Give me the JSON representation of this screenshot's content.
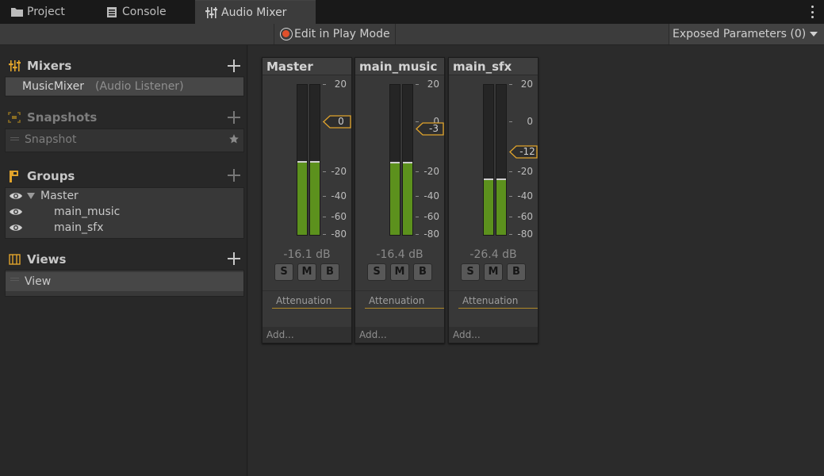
{
  "tabs": [
    {
      "label": "Project",
      "icon": "folder-icon"
    },
    {
      "label": "Console",
      "icon": "console-icon"
    },
    {
      "label": "Audio Mixer",
      "icon": "mixer-icon",
      "active": true
    }
  ],
  "toolbar": {
    "edit_play_mode": "Edit in Play Mode",
    "exposed_parameters": "Exposed Parameters (0)"
  },
  "sidebar": {
    "mixers": {
      "title": "Mixers",
      "items": [
        {
          "name": "MusicMixer",
          "note": "(Audio Listener)"
        }
      ]
    },
    "snapshots": {
      "title": "Snapshots",
      "items": [
        {
          "name": "Snapshot"
        }
      ]
    },
    "groups": {
      "title": "Groups",
      "items": [
        {
          "name": "Master",
          "level": 0
        },
        {
          "name": "main_music",
          "level": 1
        },
        {
          "name": "main_sfx",
          "level": 1
        }
      ]
    },
    "views": {
      "title": "Views",
      "items": [
        {
          "name": "View"
        }
      ]
    }
  },
  "strips": [
    {
      "name": "Master",
      "db": "-16.1 dB",
      "fader_label": "0",
      "fader_db": 0,
      "level_db": -16.1,
      "peak_db": -16.1
    },
    {
      "name": "main_music",
      "db": "-16.4 dB",
      "fader_label": "-3",
      "fader_db": -3,
      "level_db": -16.4,
      "peak_db": -16.4
    },
    {
      "name": "main_sfx",
      "db": "-26.4 dB",
      "fader_label": "-12",
      "fader_db": -12,
      "level_db": -26.4,
      "peak_db": -26.4
    }
  ],
  "strip_common": {
    "scale_labels": [
      "20",
      "0",
      "-20",
      "-40",
      "-60",
      "-80"
    ],
    "solo": "S",
    "mute": "M",
    "bypass": "B",
    "effect": "Attenuation",
    "add": "Add..."
  },
  "colors": {
    "meter_green": "#5c911d",
    "accent_orange": "#e0a32b",
    "record_red": "#e0502b"
  }
}
